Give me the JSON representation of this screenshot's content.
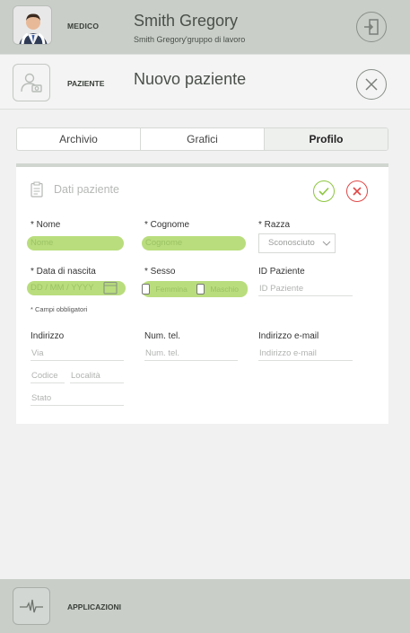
{
  "header": {
    "role_label": "MEDICO",
    "doctor_name": "Smith Gregory",
    "doctor_group": "Smith Gregory'gruppo di lavoro"
  },
  "patient_header": {
    "label": "PAZIENTE",
    "title": "Nuovo paziente"
  },
  "tabs": [
    {
      "label": "Archivio",
      "active": false
    },
    {
      "label": "Grafici",
      "active": false
    },
    {
      "label": "Profilo",
      "active": true
    }
  ],
  "form": {
    "title": "Dati paziente",
    "nome": {
      "label": "* Nome",
      "placeholder": "Nome"
    },
    "cognome": {
      "label": "* Cognome",
      "placeholder": "Cognome"
    },
    "razza": {
      "label": "* Razza",
      "value": "Sconosciuto"
    },
    "data_nascita": {
      "label": "* Data di nascita",
      "placeholder": "DD / MM / YYYY"
    },
    "sesso": {
      "label": "* Sesso",
      "options": [
        "Femmina",
        "Maschio"
      ]
    },
    "id_paziente": {
      "label": "ID Paziente",
      "placeholder": "ID Paziente"
    },
    "required_note": "* Campi obbligatori",
    "indirizzo": {
      "label": "Indirizzo",
      "via": "Via",
      "codice": "Codice",
      "localita": "Località",
      "stato": "Stato"
    },
    "num_tel": {
      "label": "Num. tel.",
      "placeholder": "Num. tel."
    },
    "email": {
      "label": "Indirizzo e-mail",
      "placeholder": "Indirizzo e-mail"
    }
  },
  "bottom": {
    "label": "APPLICAZIONI"
  },
  "colors": {
    "accent_green": "#8dc63f",
    "highlight": "#b9dd7d",
    "cancel_red": "#e04848",
    "header_bg": "#c9cec9"
  },
  "icons": [
    "doctor-avatar",
    "logout-icon",
    "patient-icon",
    "close-icon",
    "clipboard-icon",
    "check-icon",
    "x-icon",
    "calendar-icon",
    "chevron-down-icon",
    "ecg-icon"
  ]
}
